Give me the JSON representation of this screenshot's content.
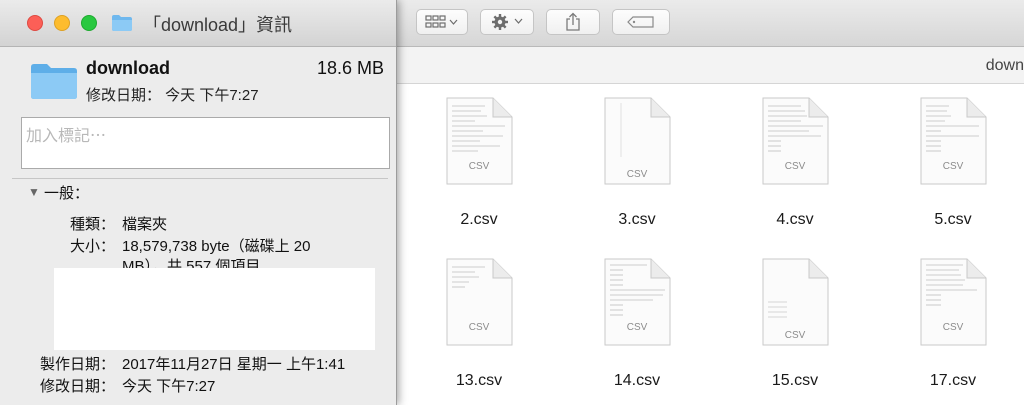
{
  "finder": {
    "path_title": "down",
    "files": [
      {
        "name": "2.csv",
        "icon_label": "CSV",
        "style": "data"
      },
      {
        "name": "3.csv",
        "icon_label": "CSV",
        "style": "blank"
      },
      {
        "name": "4.csv",
        "icon_label": "CSV",
        "style": "data"
      },
      {
        "name": "5.csv",
        "icon_label": "CSV",
        "style": "data"
      },
      {
        "name": "13.csv",
        "icon_label": "CSV",
        "style": "data"
      },
      {
        "name": "14.csv",
        "icon_label": "CSV",
        "style": "data"
      },
      {
        "name": "15.csv",
        "icon_label": "CSV",
        "style": "sparse"
      },
      {
        "name": "17.csv",
        "icon_label": "CSV",
        "style": "data"
      }
    ]
  },
  "info": {
    "title": "「download」資訊",
    "name": "download",
    "size": "18.6 MB",
    "modified_summary": "修改日期： 今天 下午7:27",
    "tags_placeholder": "加入標記⋯",
    "general_section": "一般：",
    "kind_label": "種類：",
    "kind_value": "檔案夾",
    "size_label": "大小：",
    "size_value_line1": "18,579,738 byte（磁碟上 20",
    "size_value_line2": "MB），共 557 個項目",
    "created_label": "製作日期：",
    "created_value": "2017年11月27日 星期一 上午1:41",
    "modified_label": "修改日期：",
    "modified_value": "今天 下午7:27"
  },
  "colors": {
    "close": "#fc5f57",
    "minimize": "#fdbc2e",
    "zoom": "#29c840",
    "folder": "#6fb8ee"
  }
}
